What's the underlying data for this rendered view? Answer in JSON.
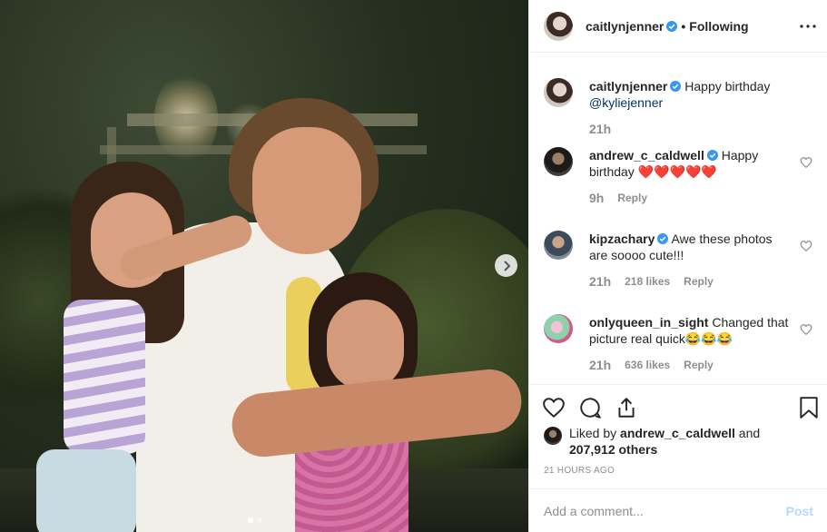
{
  "header": {
    "username": "caitlynjenner",
    "separator": "•",
    "follow_status": "Following"
  },
  "caption": {
    "username": "caitlynjenner",
    "text": "Happy birthday",
    "mention": "@kyliejenner",
    "time": "21h"
  },
  "comments": [
    {
      "username": "andrew_c_caldwell",
      "verified": true,
      "text": "Happy birthday ❤️❤️❤️❤️❤️",
      "time": "9h",
      "likes": "",
      "reply": "Reply"
    },
    {
      "username": "kipzachary",
      "verified": true,
      "text": "Awe these photos are soooo cute!!!",
      "time": "21h",
      "likes": "218 likes",
      "reply": "Reply"
    },
    {
      "username": "onlyqueen_in_sight",
      "verified": false,
      "text": "Changed that picture real quick😂😂😂",
      "time": "21h",
      "likes": "636 likes",
      "reply": "Reply"
    }
  ],
  "liked_by": {
    "prefix": "Liked by",
    "user": "andrew_c_caldwell",
    "conj": "and",
    "others": "207,912 others"
  },
  "posted_ago": "21 HOURS AGO",
  "composer": {
    "placeholder": "Add a comment...",
    "post_label": "Post"
  },
  "carousel": {
    "total_slides": 2,
    "active_slide": 1
  },
  "colors": {
    "verified": "#3897f0",
    "post_button_disabled": "#b3dbff",
    "meta_gray": "#8e8e8e"
  },
  "icons": [
    "chevron-right-icon",
    "more-icon",
    "verified-icon",
    "heart-icon",
    "comment-icon",
    "share-icon",
    "bookmark-icon"
  ]
}
